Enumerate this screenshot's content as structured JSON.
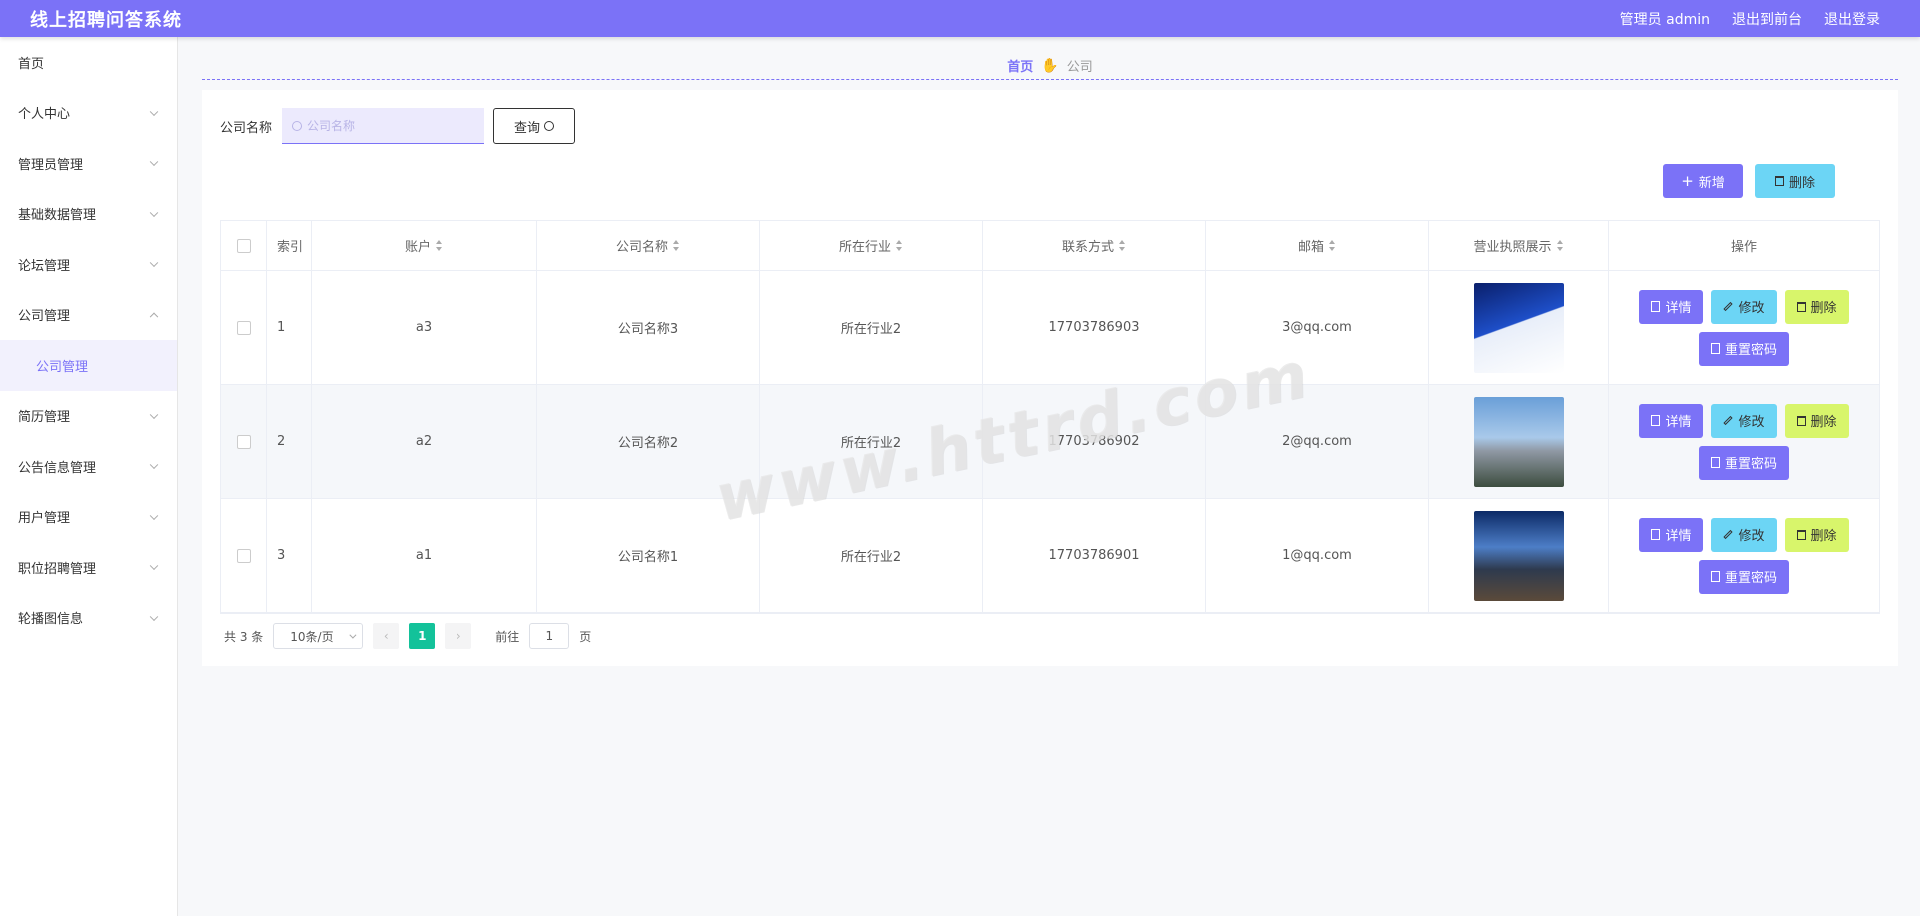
{
  "header": {
    "title": "线上招聘问答系统",
    "user": "管理员 admin",
    "to_front": "退出到前台",
    "logout": "退出登录"
  },
  "sidebar": {
    "items": [
      {
        "label": "首页"
      },
      {
        "label": "个人中心"
      },
      {
        "label": "管理员管理"
      },
      {
        "label": "基础数据管理"
      },
      {
        "label": "论坛管理"
      },
      {
        "label": "公司管理"
      },
      {
        "label": "公司管理"
      },
      {
        "label": "简历管理"
      },
      {
        "label": "公告信息管理"
      },
      {
        "label": "用户管理"
      },
      {
        "label": "职位招聘管理"
      },
      {
        "label": "轮播图信息"
      }
    ]
  },
  "breadcrumb": {
    "home": "首页",
    "current": "公司"
  },
  "search": {
    "label": "公司名称",
    "placeholder": "公司名称",
    "button": "查询"
  },
  "toolbar": {
    "add": "新增",
    "delete": "删除"
  },
  "table": {
    "headers": [
      "索引",
      "账户",
      "公司名称",
      "所在行业",
      "联系方式",
      "邮箱",
      "营业执照展示",
      "操作"
    ],
    "rows": [
      {
        "index": "1",
        "account": "a3",
        "company": "公司名称3",
        "industry": "所在行业2",
        "phone": "17703786903",
        "email": "3@qq.com"
      },
      {
        "index": "2",
        "account": "a2",
        "company": "公司名称2",
        "industry": "所在行业2",
        "phone": "17703786902",
        "email": "2@qq.com"
      },
      {
        "index": "3",
        "account": "a1",
        "company": "公司名称1",
        "industry": "所在行业2",
        "phone": "17703786901",
        "email": "1@qq.com"
      }
    ],
    "actions": {
      "detail": "详情",
      "edit": "修改",
      "remove": "删除",
      "reset": "重置密码"
    }
  },
  "pagination": {
    "total": "共 3 条",
    "page_size": "10条/页",
    "current": "1",
    "goto_prefix": "前往",
    "goto_value": "1",
    "goto_suffix": "页"
  },
  "watermark": "www.httrd.com"
}
